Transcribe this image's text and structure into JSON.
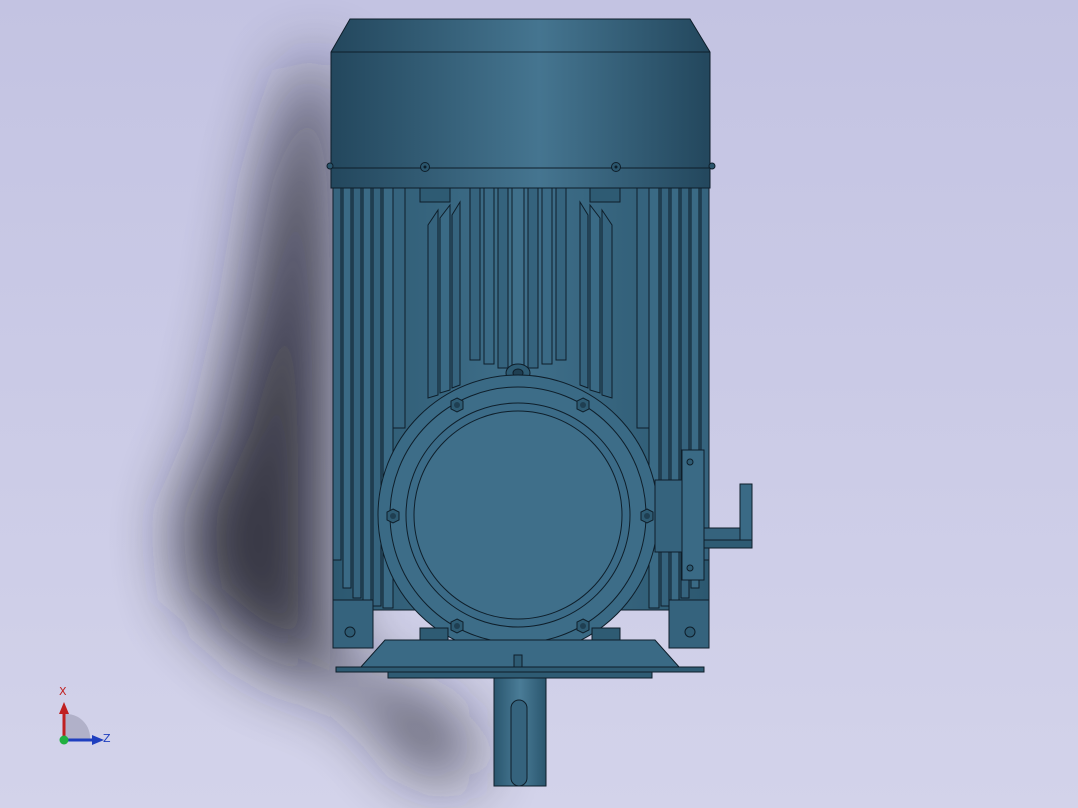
{
  "viewport": {
    "background_top": "#c3c3e2",
    "background_bottom": "#d3d3ea"
  },
  "model": {
    "body_color": "#3a6a86",
    "edge_color": "#0e1e2a",
    "shadow_color": "#1c1c28"
  },
  "triad": {
    "x_label": "X",
    "z_label": "Z",
    "x_color": "#c02020",
    "y_color": "#20b040",
    "z_color": "#1f3fbf"
  }
}
